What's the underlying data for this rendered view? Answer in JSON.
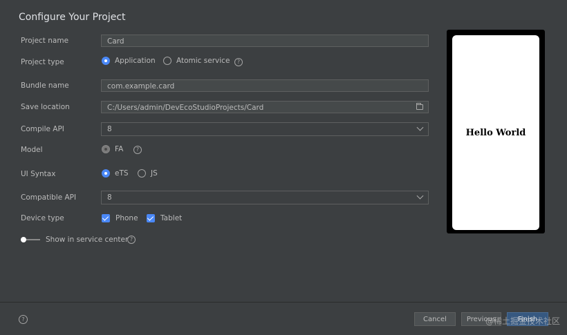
{
  "dialog": {
    "title": "Configure Your Project"
  },
  "form": {
    "project_name": {
      "label": "Project name",
      "value": "Card"
    },
    "project_type": {
      "label": "Project type",
      "options": [
        "Application",
        "Atomic service"
      ],
      "selected": "Application"
    },
    "bundle_name": {
      "label": "Bundle name",
      "value": "com.example.card"
    },
    "save_location": {
      "label": "Save location",
      "value": "C:/Users/admin/DevEcoStudioProjects/Card"
    },
    "compile_api": {
      "label": "Compile API",
      "value": "8"
    },
    "model": {
      "label": "Model",
      "options": [
        "FA"
      ],
      "selected": "FA"
    },
    "ui_syntax": {
      "label": "UI Syntax",
      "options": [
        "eTS",
        "JS"
      ],
      "selected": "eTS"
    },
    "compatible_api": {
      "label": "Compatible API",
      "value": "8"
    },
    "device_type": {
      "label": "Device type",
      "options": [
        "Phone",
        "Tablet"
      ],
      "checked": [
        "Phone",
        "Tablet"
      ]
    },
    "service_center": {
      "label": "Show in service center",
      "enabled": false
    }
  },
  "preview": {
    "text": "Hello World"
  },
  "footer": {
    "help_icon": "?",
    "cancel": "Cancel",
    "previous": "Previous",
    "finish": "Finish"
  },
  "watermark": "@稀土掘金技术社区",
  "colors": {
    "background": "#3c3f41",
    "accent": "#4a88f7",
    "primary_button": "#365880"
  },
  "icons": {
    "help": "help-icon",
    "folder": "folder-icon",
    "dropdown": "chevron-down-icon"
  }
}
